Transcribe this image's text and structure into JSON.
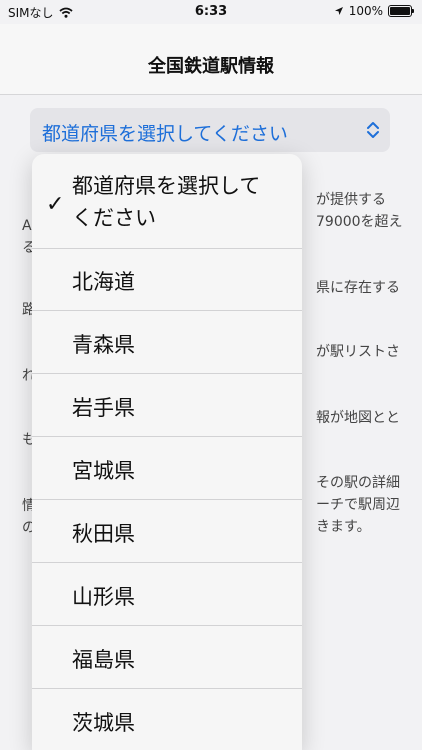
{
  "status_bar": {
    "carrier": "SIMなし",
    "time": "6:33",
    "battery": "100%",
    "battery_level": 1.0
  },
  "nav": {
    "title": "全国鉄道駅情報"
  },
  "prefecture_select": {
    "value": "都道府県を選択してください"
  },
  "background_fragments": {
    "right_1": "が提供する",
    "right_2": "79000を超え",
    "right_3": "県に存在する",
    "right_4": "が駅リストさ",
    "right_5": "報が地図とと",
    "right_6": "その駅の詳細",
    "right_7": "ーチで駅周辺",
    "right_8": "きます。",
    "left_1": "A",
    "left_2": "る",
    "left_3": "路",
    "left_4": "れ",
    "left_5": "も",
    "left_6": "情",
    "left_7": "の"
  },
  "dropdown": {
    "selected_line1": "都道府県を選択して",
    "selected_line2": "ください",
    "items": [
      "北海道",
      "青森県",
      "岩手県",
      "宮城県",
      "秋田県",
      "山形県",
      "福島県",
      "茨城県"
    ]
  }
}
